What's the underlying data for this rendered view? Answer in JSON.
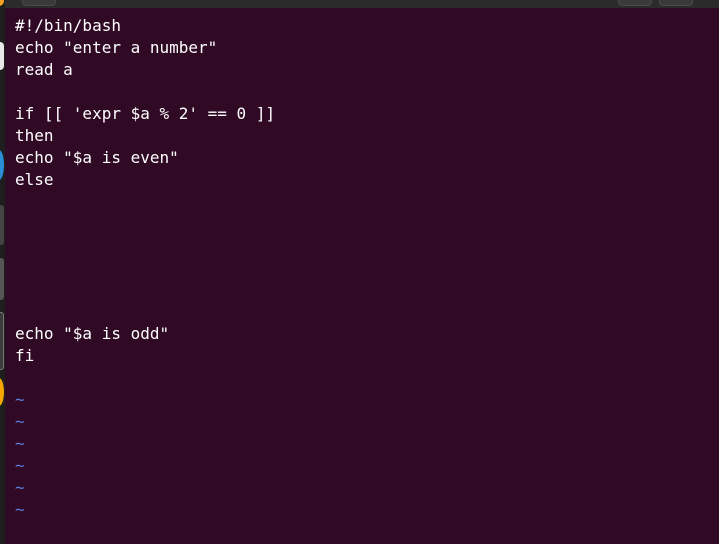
{
  "terminal": {
    "background": "#300a24",
    "foreground": "#ffffff",
    "tilde_color": "#5a7bd8",
    "lines": [
      "#!/bin/bash",
      "echo \"enter a number\"",
      "read a",
      "",
      "if [[ 'expr $a % 2' == 0 ]]",
      "then",
      "echo \"$a is even\"",
      "else",
      "",
      "",
      "",
      "",
      "",
      "",
      "echo \"$a is odd\"",
      "fi",
      "",
      "~",
      "~",
      "~",
      "~",
      "~",
      "~"
    ]
  },
  "dock": {
    "icons": [
      "firefox-icon",
      "chromium-icon",
      "files-icon",
      "terminal-icon",
      "settings-icon",
      "vlc-icon"
    ]
  }
}
